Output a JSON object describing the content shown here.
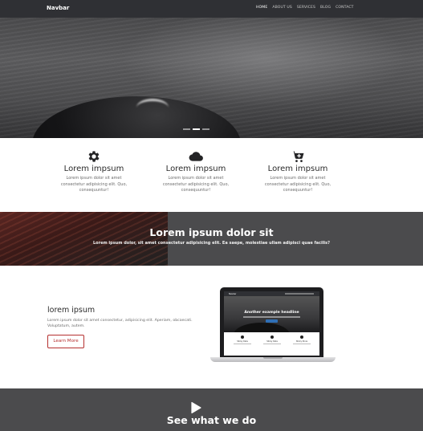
{
  "navbar": {
    "brand": "Navbar",
    "links": [
      "HOME",
      "ABOUT US",
      "SERVICES",
      "BLOG",
      "CONTACT"
    ],
    "active_index": 0
  },
  "hero": {
    "slide_count": 3,
    "active_slide": 1
  },
  "features": [
    {
      "icon": "gear-icon",
      "title": "Lorem impsum",
      "text": "Lorem ipsum dolor sit amet consectetur adipisicing elit. Quo, consequuntur!"
    },
    {
      "icon": "cloud-icon",
      "title": "Lorem impsum",
      "text": "Lorem ipsum dolor sit amet consectetur adipisicing elit. Quo, consequuntur!"
    },
    {
      "icon": "cart-plus-icon",
      "title": "Lorem impsum",
      "text": "Lorem ipsum dolor sit amet consectetur adipisicing elit. Quo, consequuntur!"
    }
  ],
  "banner": {
    "title": "Lorem ipsum dolor sit",
    "subtitle": "Lorem ipsum dolor, sit amet consectetur adipisicing elit. Ea saepe, molestiae ullam adipisci quae facilis?"
  },
  "about": {
    "title": "lorem ipsum",
    "text": "Lorem ipsum dolor sit amet consectetur, adipisicing elit. Aperiam, obcaecati. Voluptatum, autem.",
    "button": "Learn More",
    "button_color": "#b5302f"
  },
  "mockup": {
    "brand": "Navbar",
    "hero_title": "Another example headline",
    "features": [
      "Sticky Data",
      "Sticky Data",
      "Sticky Store"
    ]
  },
  "section_video": {
    "icon": "play-icon",
    "title": "See what we do"
  }
}
